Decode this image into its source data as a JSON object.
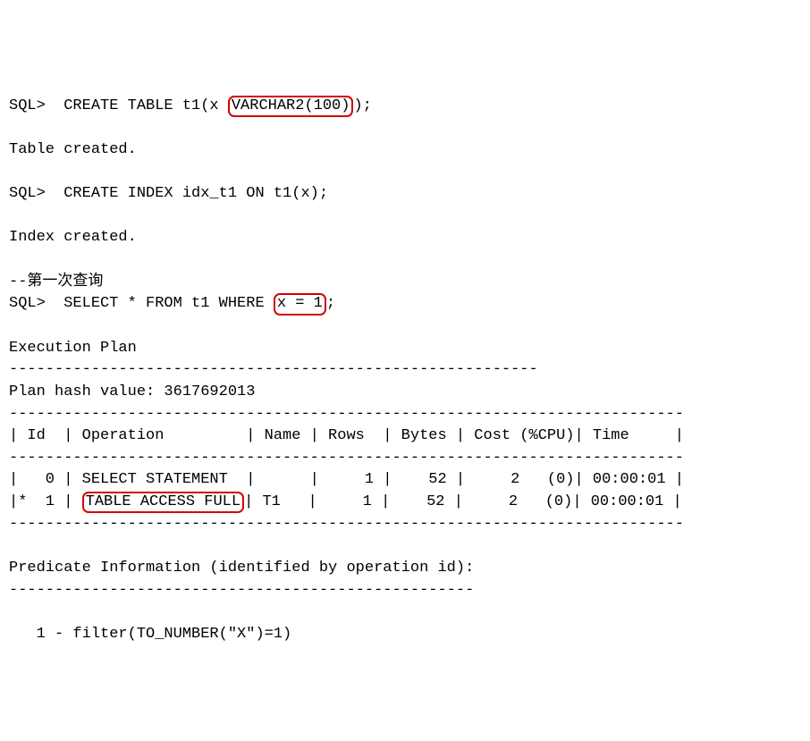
{
  "lines": {
    "l1a": "SQL>  CREATE TABLE t1(x ",
    "l1hl": "VARCHAR2(100)",
    "l1b": ");",
    "l2": "",
    "l3": "Table created.",
    "l4": "",
    "l5": "SQL>  CREATE INDEX idx_t1 ON t1(x);",
    "l6": "",
    "l7": "Index created.",
    "l8": "",
    "l9": "--第一次查询",
    "l10a": "SQL>  SELECT * FROM t1 WHERE ",
    "l10hl": "x = 1",
    "l10b": ";",
    "l11": "",
    "l12": "Execution Plan",
    "l13": "----------------------------------------------------------",
    "l14": "Plan hash value: 3617692013",
    "l15": "--------------------------------------------------------------------------",
    "l16": "| Id  | Operation         | Name | Rows  | Bytes | Cost (%CPU)| Time     |",
    "l17": "--------------------------------------------------------------------------",
    "l18": "|   0 | SELECT STATEMENT  |      |     1 |    52 |     2   (0)| 00:00:01 |",
    "l19a": "|*  1 | ",
    "l19hl": "TABLE ACCESS FULL",
    "l19b": "| T1   |     1 |    52 |     2   (0)| 00:00:01 |",
    "l20": "--------------------------------------------------------------------------",
    "l21": "",
    "l22": "Predicate Information (identified by operation id):",
    "l23": "---------------------------------------------------",
    "l24": "",
    "l25": "   1 - filter(TO_NUMBER(\"X\")=1)"
  },
  "highlight_color": "#d40000"
}
